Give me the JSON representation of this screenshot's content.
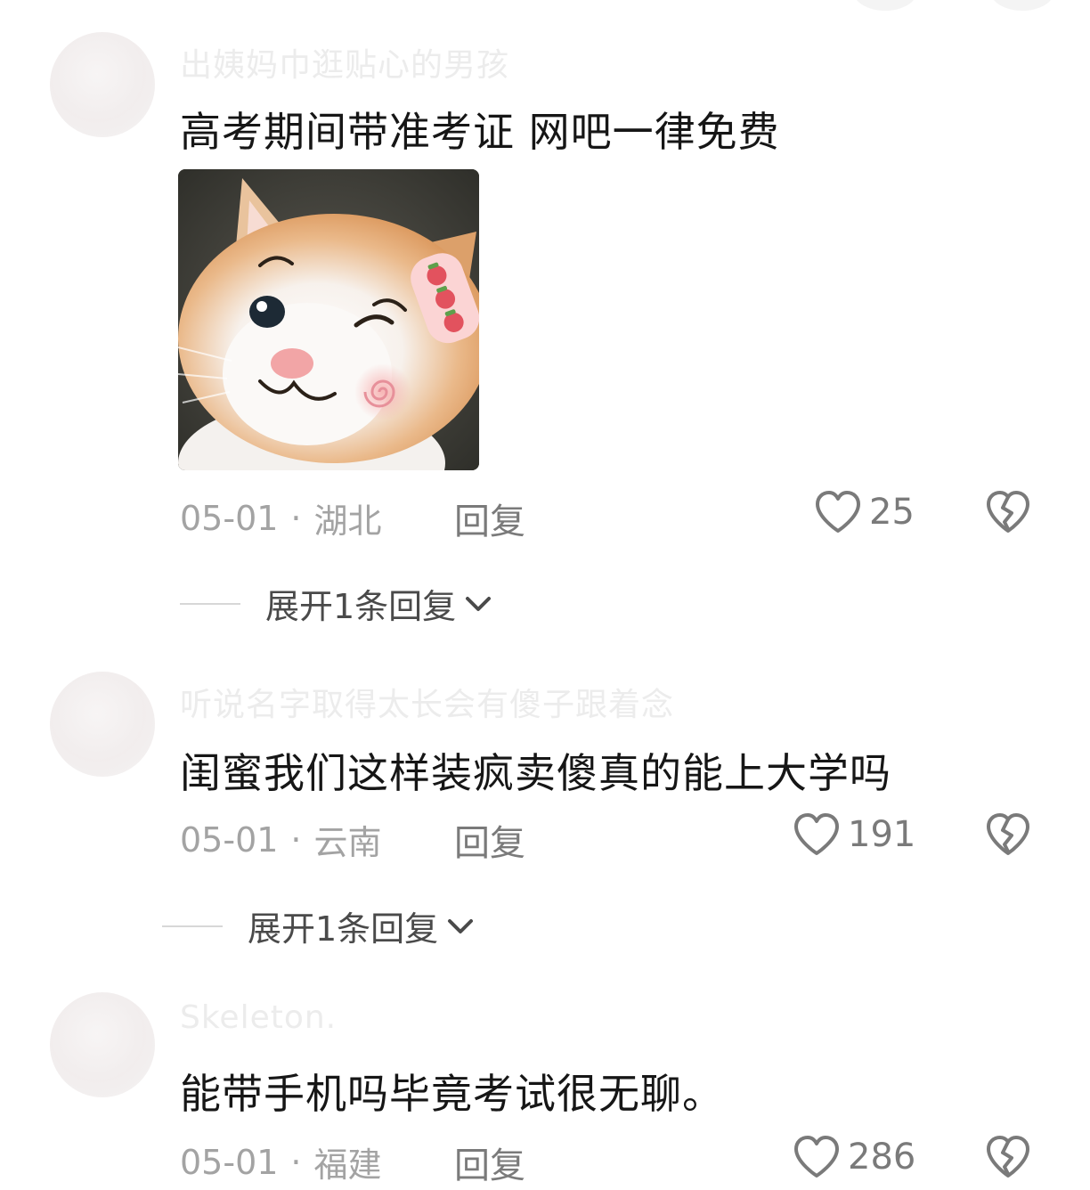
{
  "comments": [
    {
      "username": "出姨妈巾逛贴心的男孩",
      "text": "高考期间带准考证  网吧一律免费",
      "has_sticker": true,
      "date": "05-01",
      "location": "湖北",
      "reply_label": "回复",
      "likes": "25",
      "expand_label": "展开1条回复"
    },
    {
      "username": "听说名字取得太长会有傻子跟着念",
      "text": "闺蜜我们这样装疯卖傻真的能上大学吗",
      "has_sticker": false,
      "date": "05-01",
      "location": "云南",
      "reply_label": "回复",
      "likes": "191",
      "expand_label": "展开1条回复"
    },
    {
      "username": "Skeleton.",
      "text": "能带手机吗毕竟考试很无聊。",
      "has_sticker": false,
      "date": "05-01",
      "location": "福建",
      "reply_label": "回复",
      "likes": "286"
    }
  ],
  "meta_separator": "·",
  "icons": {
    "like": "heart-outline-icon",
    "dislike": "broken-heart-icon",
    "expand": "chevron-down-icon"
  },
  "colors": {
    "text": "#161616",
    "meta": "#a3a3a3",
    "action": "#7a7a7a"
  }
}
